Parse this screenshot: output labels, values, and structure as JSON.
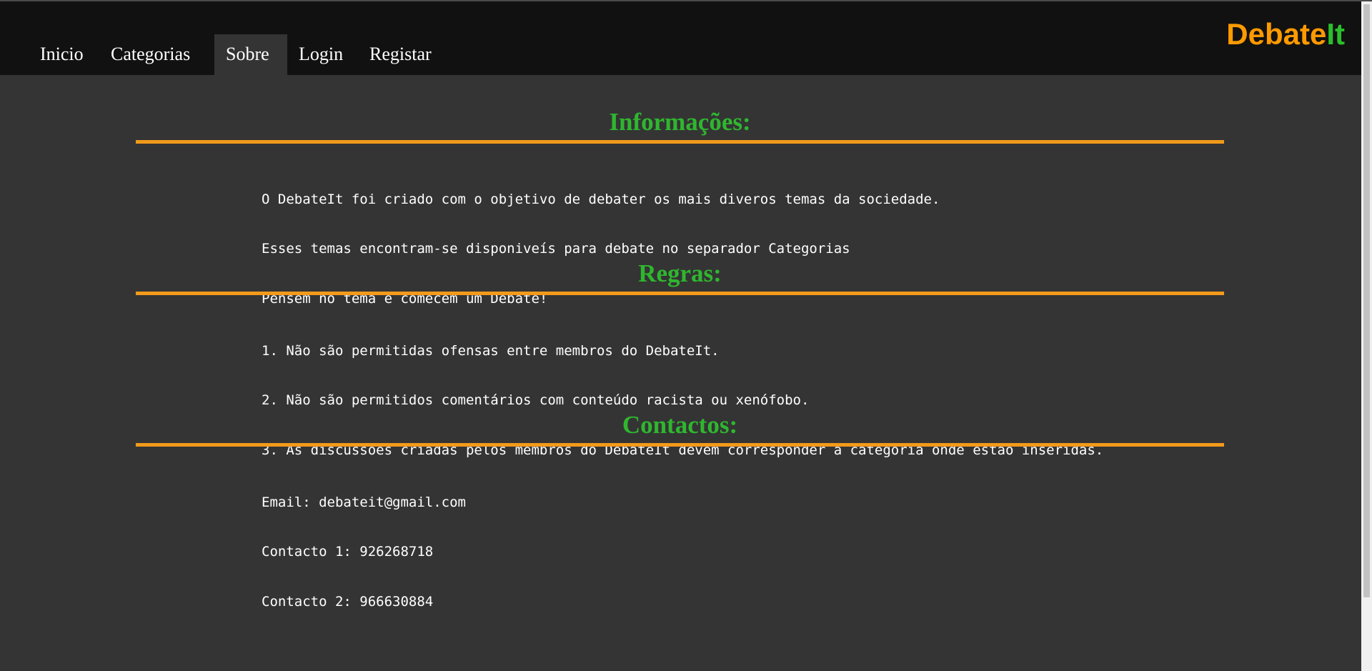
{
  "nav": {
    "items": [
      {
        "label": "Inicio"
      },
      {
        "label": "Categorias"
      },
      {
        "label": "Sobre"
      },
      {
        "label": "Login"
      },
      {
        "label": "Registar"
      }
    ],
    "active": "Sobre"
  },
  "logo": {
    "part1": "Debate",
    "part2": "It"
  },
  "sections": {
    "info": {
      "title": "Informações:",
      "lines": [
        "O DebateIt foi criado com o objetivo de debater os mais diveros temas da sociedade.",
        "Esses temas encontram-se disponiveís para debate no separador Categorias",
        "Pensem no tema e comecem um Debate!"
      ]
    },
    "rules": {
      "title": "Regras:",
      "lines": [
        "1. Não são permitidas ofensas entre membros do DebateIt.",
        "2. Não são permitidos comentários com conteúdo racista ou xenófobo.",
        "3. As discussões criadas pelos membros do DebateIt devem corresponder à categoria onde estão inseridas."
      ]
    },
    "contacts": {
      "title": "Contactos:",
      "lines": [
        "Email: debateit@gmail.com",
        "Contacto 1: 926268718",
        "Contacto 2: 966630884"
      ]
    }
  },
  "colors": {
    "accent_orange": "#ff9a00",
    "accent_green": "#2bbf2b",
    "background": "#343434",
    "navbar": "#111111"
  }
}
